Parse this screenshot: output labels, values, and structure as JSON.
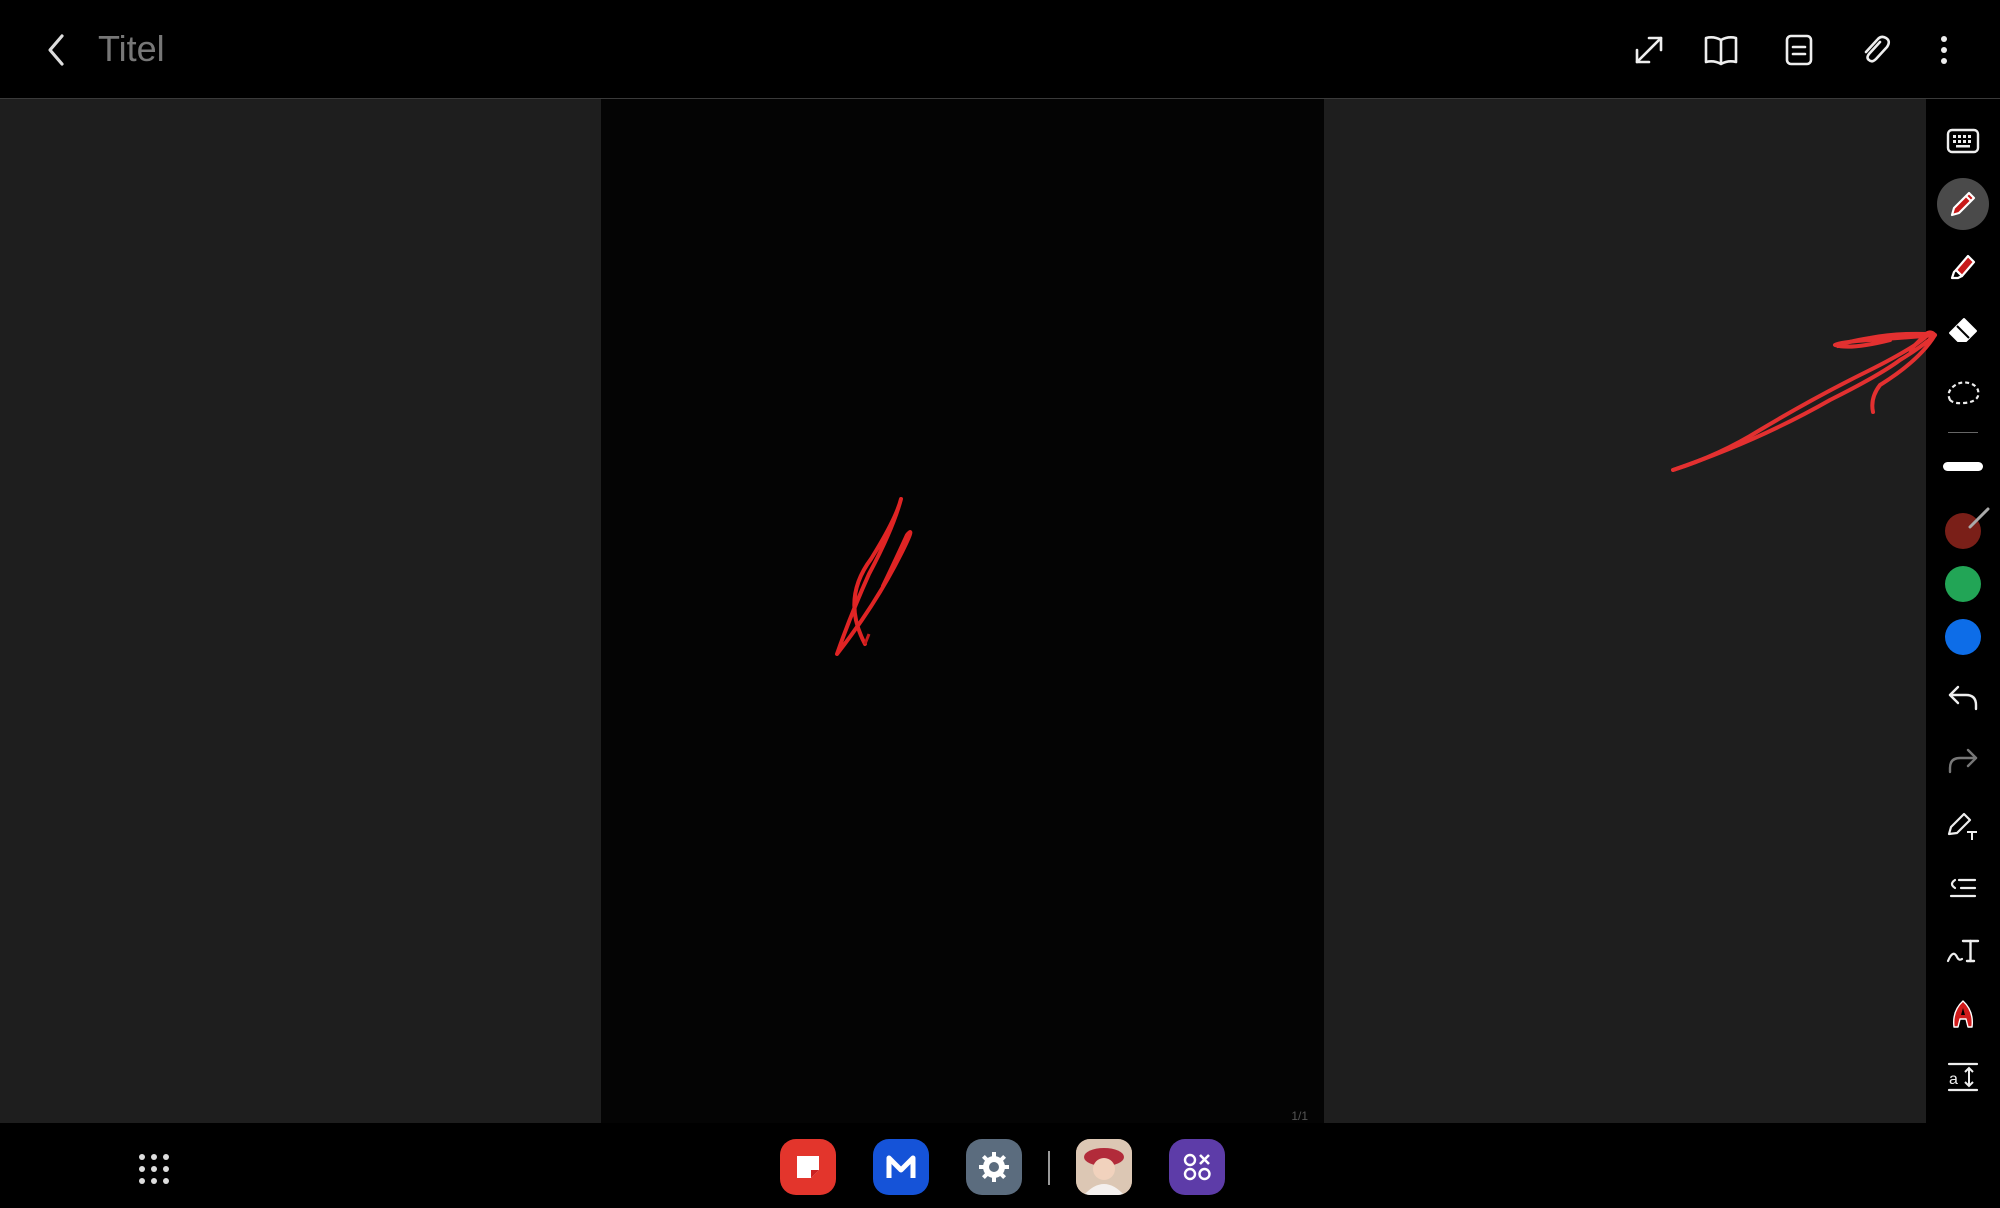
{
  "window": {
    "title": "Titel"
  },
  "topbar": {
    "icons": [
      "back-icon",
      "fullscreen-icon",
      "book-view-icon",
      "page-layout-icon",
      "attach-icon",
      "more-options-icon"
    ]
  },
  "page": {
    "indicator": "1/1"
  },
  "toolbar": {
    "tools": [
      "keyboard-icon",
      "pen-icon",
      "highlighter-icon",
      "eraser-icon",
      "lasso-icon",
      "undo-icon",
      "redo-icon",
      "handwriting-to-text-icon",
      "straighten-icon",
      "text-style-icon",
      "font-color-icon",
      "text-size-icon"
    ],
    "active_tool": "pen",
    "colors": [
      "#7a1f18",
      "#22a556",
      "#0d6de8"
    ],
    "selected_color": "#7a1f18"
  },
  "annotations": {
    "stroke_color": "#e02424"
  },
  "dock": {
    "apps": [
      "notes-app",
      "mail-app",
      "settings-app",
      "profile-app",
      "tools-app"
    ]
  }
}
